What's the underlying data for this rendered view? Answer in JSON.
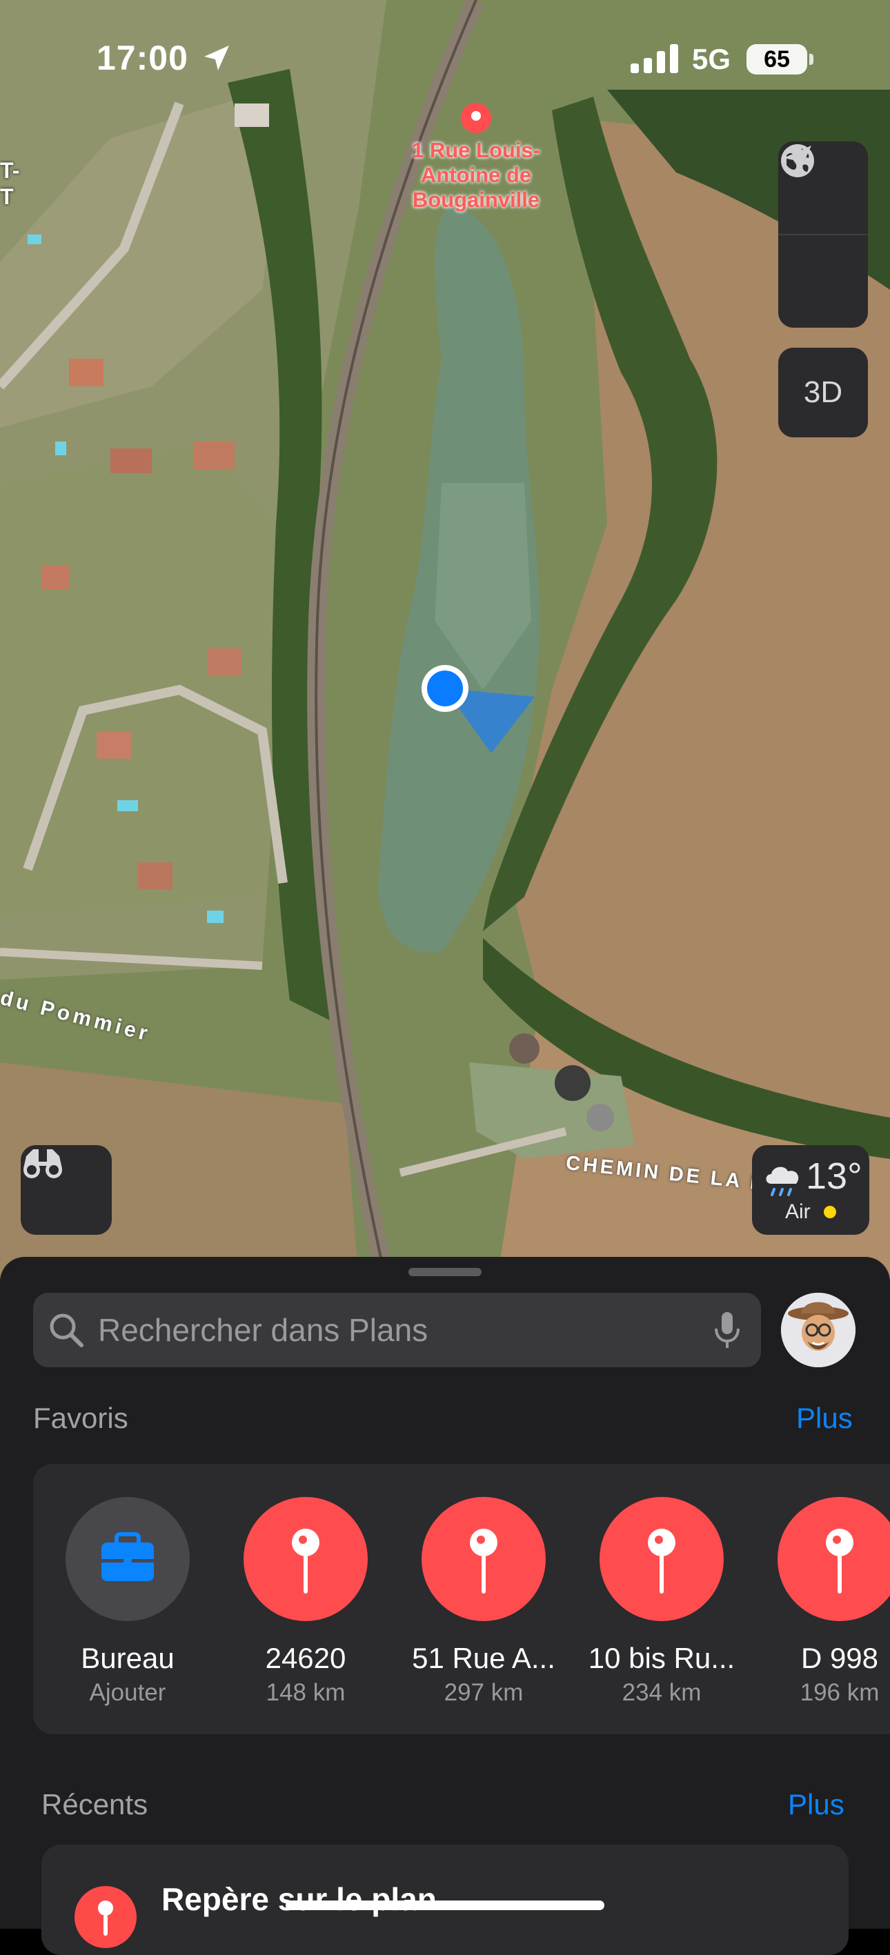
{
  "status_bar": {
    "time": "17:00",
    "network": "5G",
    "battery": "65",
    "icons": [
      "location-arrow-icon",
      "signal-icon"
    ]
  },
  "map": {
    "pin_label": "1 Rue Louis-Antoine de Bougainville",
    "pin_label_lines": [
      "1 Rue Louis-",
      "Antoine de",
      "Bougainville"
    ],
    "edge_label_lines": [
      "T-",
      "T"
    ],
    "street_1": "du Pommier",
    "street_2": "CHEMIN DE LA B",
    "controls": {
      "globe": "globe-icon",
      "locate": "location-arrow-icon",
      "three_d": "3D"
    },
    "weather": {
      "temp": "13°",
      "air": "Air",
      "icon": "cloud-rain-icon",
      "air_quality_color": "#ffd60a"
    }
  },
  "sheet": {
    "search_placeholder": "Rechercher dans Plans",
    "favorites_title": "Favoris",
    "favorites_more": "Plus",
    "favorites": [
      {
        "name": "Bureau",
        "sub": "Ajouter",
        "icon": "briefcase-icon",
        "color": "#48474b"
      },
      {
        "name": "24620",
        "sub": "148 km",
        "icon": "pin-icon",
        "color": "#ff4d4f"
      },
      {
        "name": "51 Rue A...",
        "sub": "297 km",
        "icon": "pin-icon",
        "color": "#ff4d4f"
      },
      {
        "name": "10 bis Ru...",
        "sub": "234 km",
        "icon": "pin-icon",
        "color": "#ff4d4f"
      },
      {
        "name": "D 998",
        "sub": "196 km",
        "icon": "pin-icon",
        "color": "#ff4d4f"
      }
    ],
    "recents_title": "Récents",
    "recents_more": "Plus",
    "recents": [
      {
        "title": "Repère sur le plan"
      }
    ]
  },
  "colors": {
    "accent": "#0a84ff",
    "sheet_bg": "#1e1d1f",
    "card_bg": "#2b2a2d"
  }
}
